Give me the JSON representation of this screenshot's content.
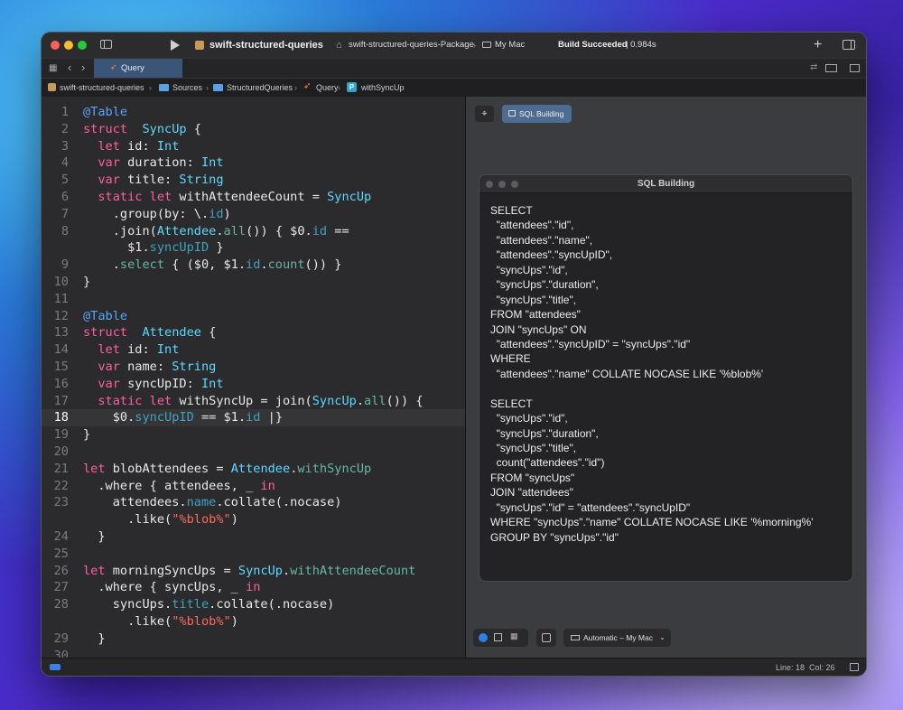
{
  "toolbar": {
    "project": "swift-structured-queries",
    "scheme": "swift-structured-queries-Package",
    "destination": "My Mac",
    "build_status_bold": "Build Succeeded",
    "build_status_time": "| 0.984s"
  },
  "tab": {
    "label": "Query"
  },
  "breadcrumb": [
    "swift-structured-queries",
    "Sources",
    "StructuredQueries",
    "Query",
    "withSyncUp"
  ],
  "editor": {
    "current_line": 18,
    "lines": [
      {
        "n": "1",
        "t": [
          [
            "attr",
            "@Table"
          ]
        ]
      },
      {
        "n": "2",
        "t": [
          [
            "kw",
            "struct"
          ],
          [
            "",
            "  "
          ],
          [
            "ty",
            "SyncUp"
          ],
          [
            "",
            " {"
          ]
        ]
      },
      {
        "n": "3",
        "t": [
          [
            "",
            "  "
          ],
          [
            "kw",
            "let"
          ],
          [
            "",
            " id: "
          ],
          [
            "ty",
            "Int"
          ]
        ]
      },
      {
        "n": "4",
        "t": [
          [
            "",
            "  "
          ],
          [
            "kw",
            "var"
          ],
          [
            "",
            " duration: "
          ],
          [
            "ty",
            "Int"
          ]
        ]
      },
      {
        "n": "5",
        "t": [
          [
            "",
            "  "
          ],
          [
            "kw",
            "var"
          ],
          [
            "",
            " title: "
          ],
          [
            "ty",
            "String"
          ]
        ]
      },
      {
        "n": "6",
        "t": [
          [
            "",
            "  "
          ],
          [
            "kw",
            "static let"
          ],
          [
            "",
            " withAttendeeCount = "
          ],
          [
            "ty",
            "SyncUp"
          ]
        ]
      },
      {
        "n": "7",
        "t": [
          [
            "",
            "    .group(by: \\."
          ],
          [
            "pr",
            "id"
          ],
          [
            "",
            ")"
          ]
        ]
      },
      {
        "n": "8",
        "t": [
          [
            "",
            "    .join("
          ],
          [
            "ty",
            "Attendee"
          ],
          [
            "",
            "."
          ],
          [
            "fn",
            "all"
          ],
          [
            "",
            "()) { $0."
          ],
          [
            "pr",
            "id"
          ],
          [
            "",
            " =="
          ]
        ]
      },
      {
        "n": "",
        "t": [
          [
            "",
            "      $1."
          ],
          [
            "pr",
            "syncUpID"
          ],
          [
            "",
            " }"
          ]
        ]
      },
      {
        "n": "9",
        "t": [
          [
            "",
            "    ."
          ],
          [
            "fn",
            "select"
          ],
          [
            "",
            " { ($0, $1."
          ],
          [
            "pr",
            "id"
          ],
          [
            "",
            "."
          ],
          [
            "fn",
            "count"
          ],
          [
            "",
            "()) }"
          ]
        ]
      },
      {
        "n": "10",
        "t": [
          [
            "",
            "}"
          ]
        ]
      },
      {
        "n": "11",
        "t": []
      },
      {
        "n": "12",
        "t": [
          [
            "attr",
            "@Table"
          ]
        ]
      },
      {
        "n": "13",
        "t": [
          [
            "kw",
            "struct"
          ],
          [
            "",
            "  "
          ],
          [
            "ty",
            "Attendee"
          ],
          [
            "",
            " {"
          ]
        ]
      },
      {
        "n": "14",
        "t": [
          [
            "",
            "  "
          ],
          [
            "kw",
            "let"
          ],
          [
            "",
            " id: "
          ],
          [
            "ty",
            "Int"
          ]
        ]
      },
      {
        "n": "15",
        "t": [
          [
            "",
            "  "
          ],
          [
            "kw",
            "var"
          ],
          [
            "",
            " name: "
          ],
          [
            "ty",
            "String"
          ]
        ]
      },
      {
        "n": "16",
        "t": [
          [
            "",
            "  "
          ],
          [
            "kw",
            "var"
          ],
          [
            "",
            " syncUpID: "
          ],
          [
            "ty",
            "Int"
          ]
        ]
      },
      {
        "n": "17",
        "t": [
          [
            "",
            "  "
          ],
          [
            "kw",
            "static let"
          ],
          [
            "",
            " withSyncUp = join("
          ],
          [
            "ty",
            "SyncUp"
          ],
          [
            "",
            "."
          ],
          [
            "fn",
            "all"
          ],
          [
            "",
            "()) {"
          ]
        ]
      },
      {
        "n": "18",
        "t": [
          [
            "",
            "    $0."
          ],
          [
            "pr",
            "syncUpID"
          ],
          [
            "",
            " == $1."
          ],
          [
            "pr",
            "id"
          ],
          [
            "",
            " |}"
          ]
        ]
      },
      {
        "n": "19",
        "t": [
          [
            "",
            "}"
          ]
        ]
      },
      {
        "n": "20",
        "t": []
      },
      {
        "n": "21",
        "t": [
          [
            "kw",
            "let"
          ],
          [
            "",
            " blobAttendees = "
          ],
          [
            "ty",
            "Attendee"
          ],
          [
            "",
            "."
          ],
          [
            "fn",
            "withSyncUp"
          ]
        ]
      },
      {
        "n": "22",
        "t": [
          [
            "",
            "  .where { attendees, _ "
          ],
          [
            "kw",
            "in"
          ]
        ]
      },
      {
        "n": "23",
        "t": [
          [
            "",
            "    attendees."
          ],
          [
            "pr",
            "name"
          ],
          [
            "",
            ".collate(.nocase)"
          ]
        ]
      },
      {
        "n": "",
        "t": [
          [
            "",
            "      .like("
          ],
          [
            "st",
            "\"%blob%\""
          ],
          [
            "",
            ")"
          ]
        ]
      },
      {
        "n": "24",
        "t": [
          [
            "",
            "  }"
          ]
        ]
      },
      {
        "n": "25",
        "t": []
      },
      {
        "n": "26",
        "t": [
          [
            "kw",
            "let"
          ],
          [
            "",
            " morningSyncUps = "
          ],
          [
            "ty",
            "SyncUp"
          ],
          [
            "",
            "."
          ],
          [
            "fn",
            "withAttendeeCount"
          ]
        ]
      },
      {
        "n": "27",
        "t": [
          [
            "",
            "  .where { syncUps, _ "
          ],
          [
            "kw",
            "in"
          ]
        ]
      },
      {
        "n": "28",
        "t": [
          [
            "",
            "    syncUps."
          ],
          [
            "pr",
            "title"
          ],
          [
            "",
            ".collate(.nocase)"
          ]
        ]
      },
      {
        "n": "",
        "t": [
          [
            "",
            "      .like("
          ],
          [
            "st",
            "\"%blob%\""
          ],
          [
            "",
            ")"
          ]
        ]
      },
      {
        "n": "29",
        "t": [
          [
            "",
            "  }"
          ]
        ]
      },
      {
        "n": "30",
        "t": []
      }
    ]
  },
  "canvas": {
    "preview_tab_label": "SQL Building",
    "window_title": "SQL Building",
    "sql_lines": [
      "SELECT",
      "  \"attendees\".\"id\",",
      "  \"attendees\".\"name\",",
      "  \"attendees\".\"syncUpID\",",
      "  \"syncUps\".\"id\",",
      "  \"syncUps\".\"duration\",",
      "  \"syncUps\".\"title\",",
      "FROM \"attendees\"",
      "JOIN \"syncUps\" ON",
      "  \"attendees\".\"syncUpID\" = \"syncUps\".\"id\"",
      "WHERE",
      "  \"attendees\".\"name\" COLLATE NOCASE LIKE '%blob%'",
      "",
      "SELECT",
      "  \"syncUps\".\"id\",",
      "  \"syncUps\".\"duration\",",
      "  \"syncUps\".\"title\",",
      "  count(\"attendees\".\"id\")",
      "FROM \"syncUps\"",
      "JOIN \"attendees\"",
      "  \"syncUps\".\"id\" = \"attendees\".\"syncUpID\"",
      "WHERE \"syncUps\".\"name\" COLLATE NOCASE LIKE '%morning%'",
      "GROUP BY \"syncUps\".\"id\""
    ],
    "device_label": "Automatic – My Mac"
  },
  "status": {
    "position": "Line: 18  Col: 26"
  },
  "colors": {
    "keyword": "#fc5fa3",
    "type": "#5dd8ff",
    "function": "#67b7a4",
    "property": "#41a1c0",
    "string": "#fc6a5d",
    "attribute": "#59a4f9",
    "accent": "#4e86d6"
  }
}
